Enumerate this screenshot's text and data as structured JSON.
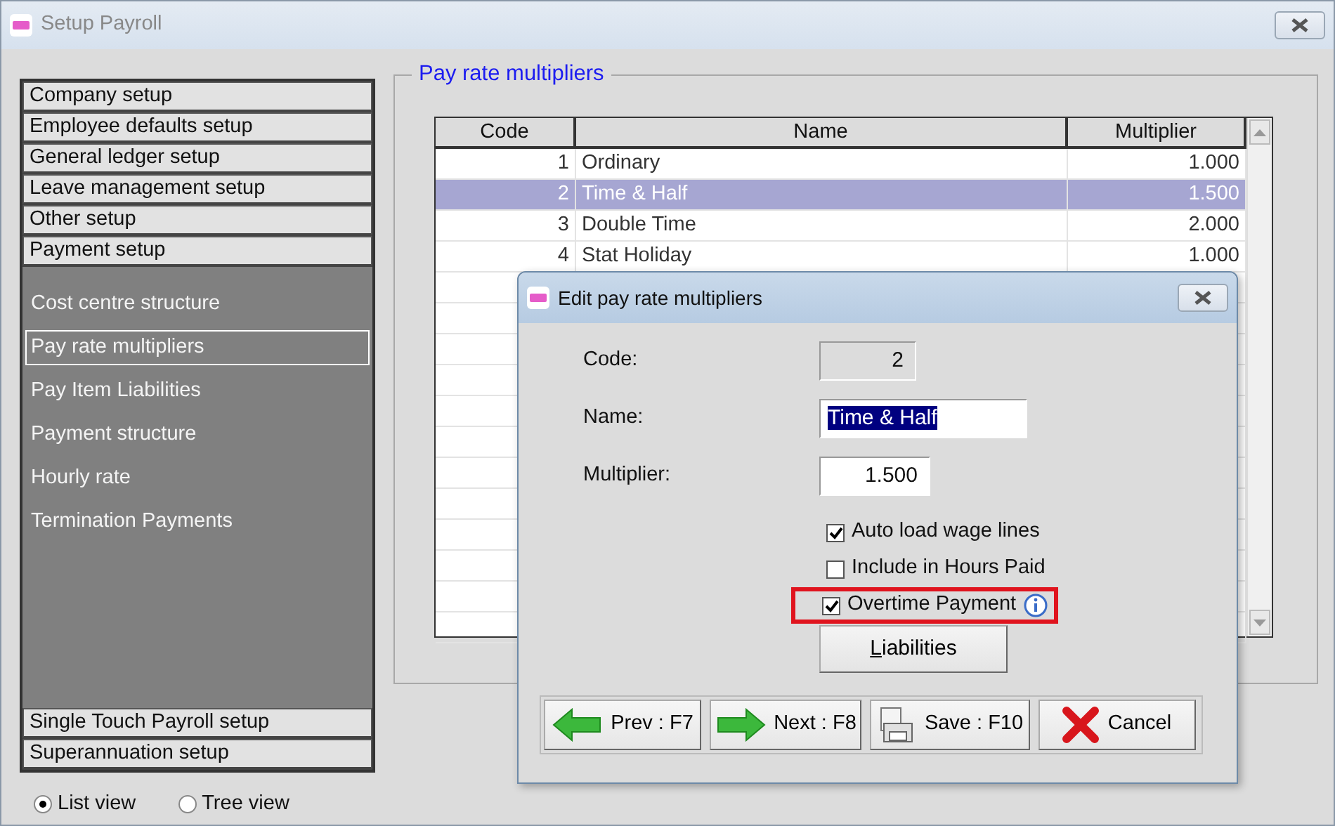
{
  "window": {
    "title": "Setup Payroll"
  },
  "sidebar": {
    "sections": [
      {
        "label": "Company setup"
      },
      {
        "label": "Employee defaults setup"
      },
      {
        "label": "General ledger setup"
      },
      {
        "label": "Leave management setup"
      },
      {
        "label": "Other setup"
      },
      {
        "label": "Payment setup",
        "children": [
          {
            "label": "Cost centre structure",
            "selected": false
          },
          {
            "label": "Pay rate multipliers",
            "selected": true
          },
          {
            "label": "Pay Item Liabilities",
            "selected": false
          },
          {
            "label": "Payment structure",
            "selected": false
          },
          {
            "label": "Hourly rate",
            "selected": false
          },
          {
            "label": "Termination Payments",
            "selected": false
          }
        ]
      },
      {
        "label": "Single Touch Payroll setup"
      },
      {
        "label": "Superannuation setup"
      }
    ],
    "views": [
      {
        "label": "List view",
        "selected": true
      },
      {
        "label": "Tree view",
        "selected": false
      }
    ]
  },
  "group": {
    "title": "Pay rate multipliers",
    "table": {
      "columns": [
        "Code",
        "Name",
        "Multiplier"
      ],
      "rows": [
        {
          "code": "1",
          "name": "Ordinary",
          "multiplier": "1.000",
          "selected": false
        },
        {
          "code": "2",
          "name": "Time & Half",
          "multiplier": "1.500",
          "selected": true
        },
        {
          "code": "3",
          "name": "Double Time",
          "multiplier": "2.000",
          "selected": false
        },
        {
          "code": "4",
          "name": "Stat Holiday",
          "multiplier": "1.000",
          "selected": false
        }
      ]
    }
  },
  "dialog": {
    "title": "Edit pay rate multipliers",
    "fields": [
      {
        "label": "Code:",
        "value": "2",
        "kind": "readonly",
        "text_selected": false
      },
      {
        "label": "Name:",
        "value": "Time & Half",
        "kind": "text",
        "text_selected": true
      },
      {
        "label": "Multiplier:",
        "value": "1.500",
        "kind": "number",
        "text_selected": false
      }
    ],
    "checkboxes": [
      {
        "label": "Auto load wage lines",
        "checked": true,
        "highlighted": false,
        "info": false
      },
      {
        "label": "Include in Hours Paid",
        "checked": false,
        "highlighted": false,
        "info": false
      },
      {
        "label": "Overtime Payment",
        "checked": true,
        "highlighted": true,
        "info": true
      }
    ],
    "liabilities_button": {
      "label": "Liabilities",
      "underline_first": true
    },
    "buttons": [
      {
        "label": "Prev : F7",
        "kind": "prev"
      },
      {
        "label": "Next : F8",
        "kind": "next"
      },
      {
        "label": "Save : F10",
        "kind": "save"
      },
      {
        "label": "Cancel",
        "kind": "cancel"
      }
    ]
  }
}
